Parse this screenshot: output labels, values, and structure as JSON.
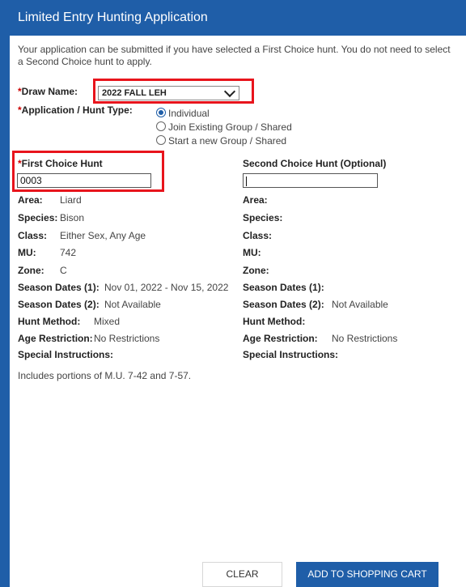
{
  "title": "Limited Entry Hunting Application",
  "intro": "Your application can be submitted if you have selected a First Choice hunt. You do not need to select a Second Choice hunt to apply.",
  "required_mark": "*",
  "draw_name": {
    "label": "Draw Name:",
    "selected": "2022 FALL LEH"
  },
  "hunt_type": {
    "label": "Application / Hunt Type:",
    "options": [
      "Individual",
      "Join Existing Group / Shared",
      "Start a new Group / Shared"
    ],
    "selected": "Individual"
  },
  "first_choice": {
    "label": "First Choice Hunt",
    "value": "0003",
    "fields": {
      "area": {
        "label": "Area:",
        "value": "Liard"
      },
      "species": {
        "label": "Species:",
        "value": "Bison"
      },
      "class": {
        "label": "Class:",
        "value": "Either Sex, Any Age"
      },
      "mu": {
        "label": "MU:",
        "value": "742"
      },
      "zone": {
        "label": "Zone:",
        "value": "C"
      },
      "season1": {
        "label": "Season Dates (1):",
        "value": "Nov 01, 2022 - Nov 15, 2022"
      },
      "season2": {
        "label": "Season Dates (2):",
        "value": "Not Available"
      },
      "method": {
        "label": "Hunt Method:",
        "value": "Mixed"
      },
      "age": {
        "label": "Age Restriction:",
        "value": "No Restrictions"
      },
      "special": {
        "label": "Special Instructions:",
        "value": "Includes portions of M.U. 7-42 and 7-57."
      }
    }
  },
  "second_choice": {
    "label": "Second Choice Hunt (Optional)",
    "value": "",
    "fields": {
      "area": {
        "label": "Area:"
      },
      "species": {
        "label": "Species:"
      },
      "class": {
        "label": "Class:"
      },
      "mu": {
        "label": "MU:"
      },
      "zone": {
        "label": "Zone:"
      },
      "season1": {
        "label": "Season Dates (1):"
      },
      "season2": {
        "label": "Season Dates (2):",
        "value": "Not Available"
      },
      "method": {
        "label": "Hunt Method:"
      },
      "age": {
        "label": "Age Restriction:",
        "value": "No Restrictions"
      },
      "special": {
        "label": "Special Instructions:"
      }
    }
  },
  "buttons": {
    "clear": "CLEAR",
    "add_to_cart": "ADD TO SHOPPING CART"
  },
  "colors": {
    "brand_blue": "#1f5ea8",
    "highlight_red": "#e8141c",
    "required_red": "#cc0000"
  }
}
